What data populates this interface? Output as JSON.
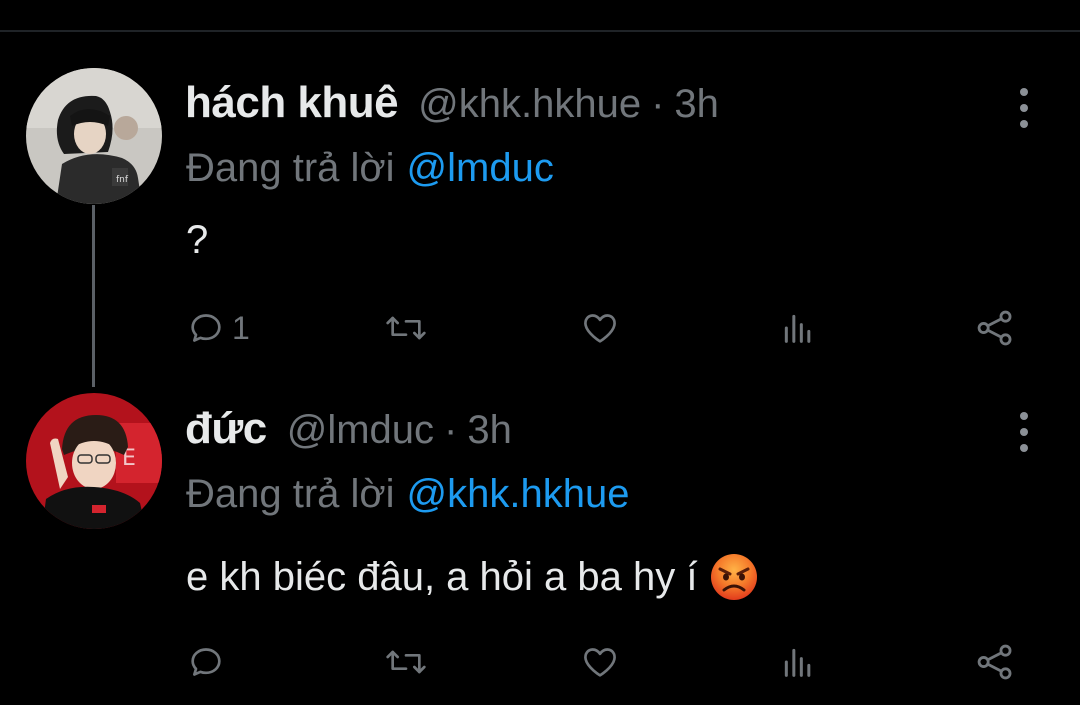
{
  "thread": [
    {
      "display_name": "hách khuê",
      "handle": "@khk.hkhue",
      "separator": "·",
      "time": "3h",
      "replying_prefix": "Đang trả lời",
      "replying_to": "@lmduc",
      "text": "?",
      "emoji": "",
      "actions": {
        "reply_icon": "comment-icon",
        "reply_count": "1",
        "retweet_icon": "retweet-icon",
        "like_icon": "heart-icon",
        "analytics_icon": "analytics-icon",
        "share_icon": "share-icon"
      }
    },
    {
      "display_name": "đức",
      "handle": "@lmduc",
      "separator": "·",
      "time": "3h",
      "replying_prefix": "Đang trả lời",
      "replying_to": "@khk.hkhue",
      "text": "e kh biéc đâu, a hỏi a ba hy í",
      "emoji": "angry-face-emoji",
      "actions": {
        "reply_icon": "comment-icon",
        "reply_count": "",
        "retweet_icon": "retweet-icon",
        "like_icon": "heart-icon",
        "analytics_icon": "analytics-icon",
        "share_icon": "share-icon"
      }
    }
  ],
  "colors": {
    "background": "#000000",
    "primary_text": "#e7e9ea",
    "secondary_text": "#71767b",
    "link": "#1d9bf0",
    "thread_line": "#5b6066"
  }
}
